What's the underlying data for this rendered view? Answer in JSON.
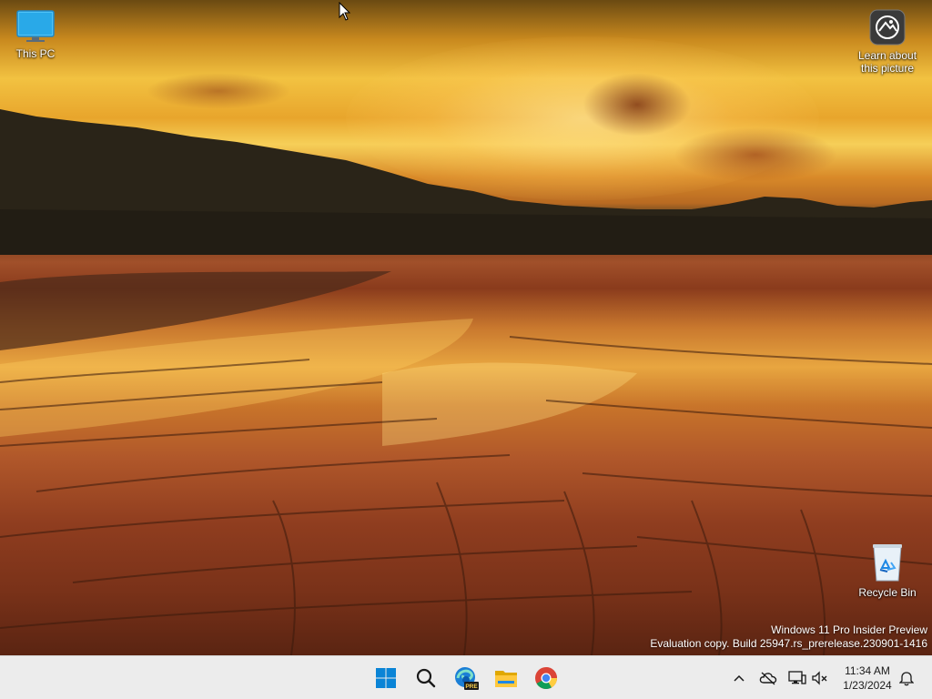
{
  "desktop": {
    "icons": {
      "this_pc": "This PC",
      "learn_picture": "Learn about this picture",
      "recycle_bin": "Recycle Bin"
    },
    "watermark": {
      "line1": "Windows 11 Pro Insider Preview",
      "line2": "Evaluation copy. Build 25947.rs_prerelease.230901-1416"
    }
  },
  "taskbar": {
    "apps": [
      {
        "name": "start",
        "icon": "windows-logo-icon"
      },
      {
        "name": "search",
        "icon": "search-icon"
      },
      {
        "name": "edge",
        "icon": "edge-dev-icon",
        "badge": "PRE"
      },
      {
        "name": "file-explorer",
        "icon": "folder-icon"
      },
      {
        "name": "chrome",
        "icon": "chrome-icon"
      }
    ],
    "tray": {
      "time": "11:34 AM",
      "date": "1/23/2024"
    }
  },
  "colors": {
    "taskbar_bg": "#ececec",
    "accent_blue": "#0078d4"
  }
}
